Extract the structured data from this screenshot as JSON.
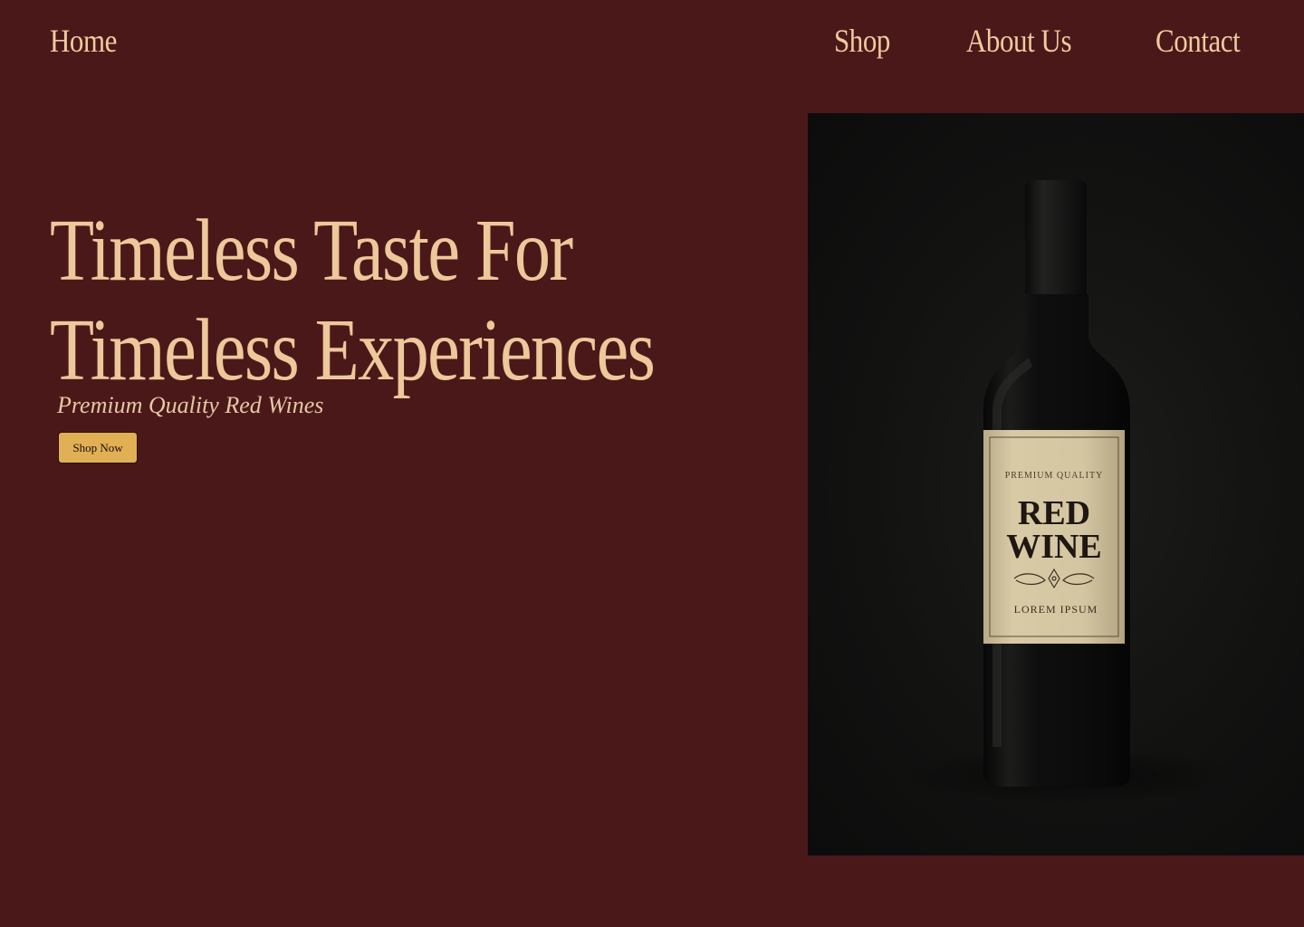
{
  "nav": {
    "home": "Home",
    "shop": "Shop",
    "about": "About Us",
    "contact": "Contact"
  },
  "hero": {
    "title_line1": "Timeless Taste For",
    "title_line2": "Timeless Experiences",
    "subtitle": "Premium Quality Red Wines",
    "cta_label": "Shop Now"
  },
  "product_image": {
    "label_top": "PREMIUM QUALITY",
    "label_line1": "RED",
    "label_line2": "WINE",
    "label_bottom": "LOREM IPSUM"
  },
  "colors": {
    "background": "#4b181a",
    "accent_text": "#edc89a",
    "button": "#e2b054",
    "photo_background": "#121211",
    "label_paper": "#d6c7a1"
  }
}
